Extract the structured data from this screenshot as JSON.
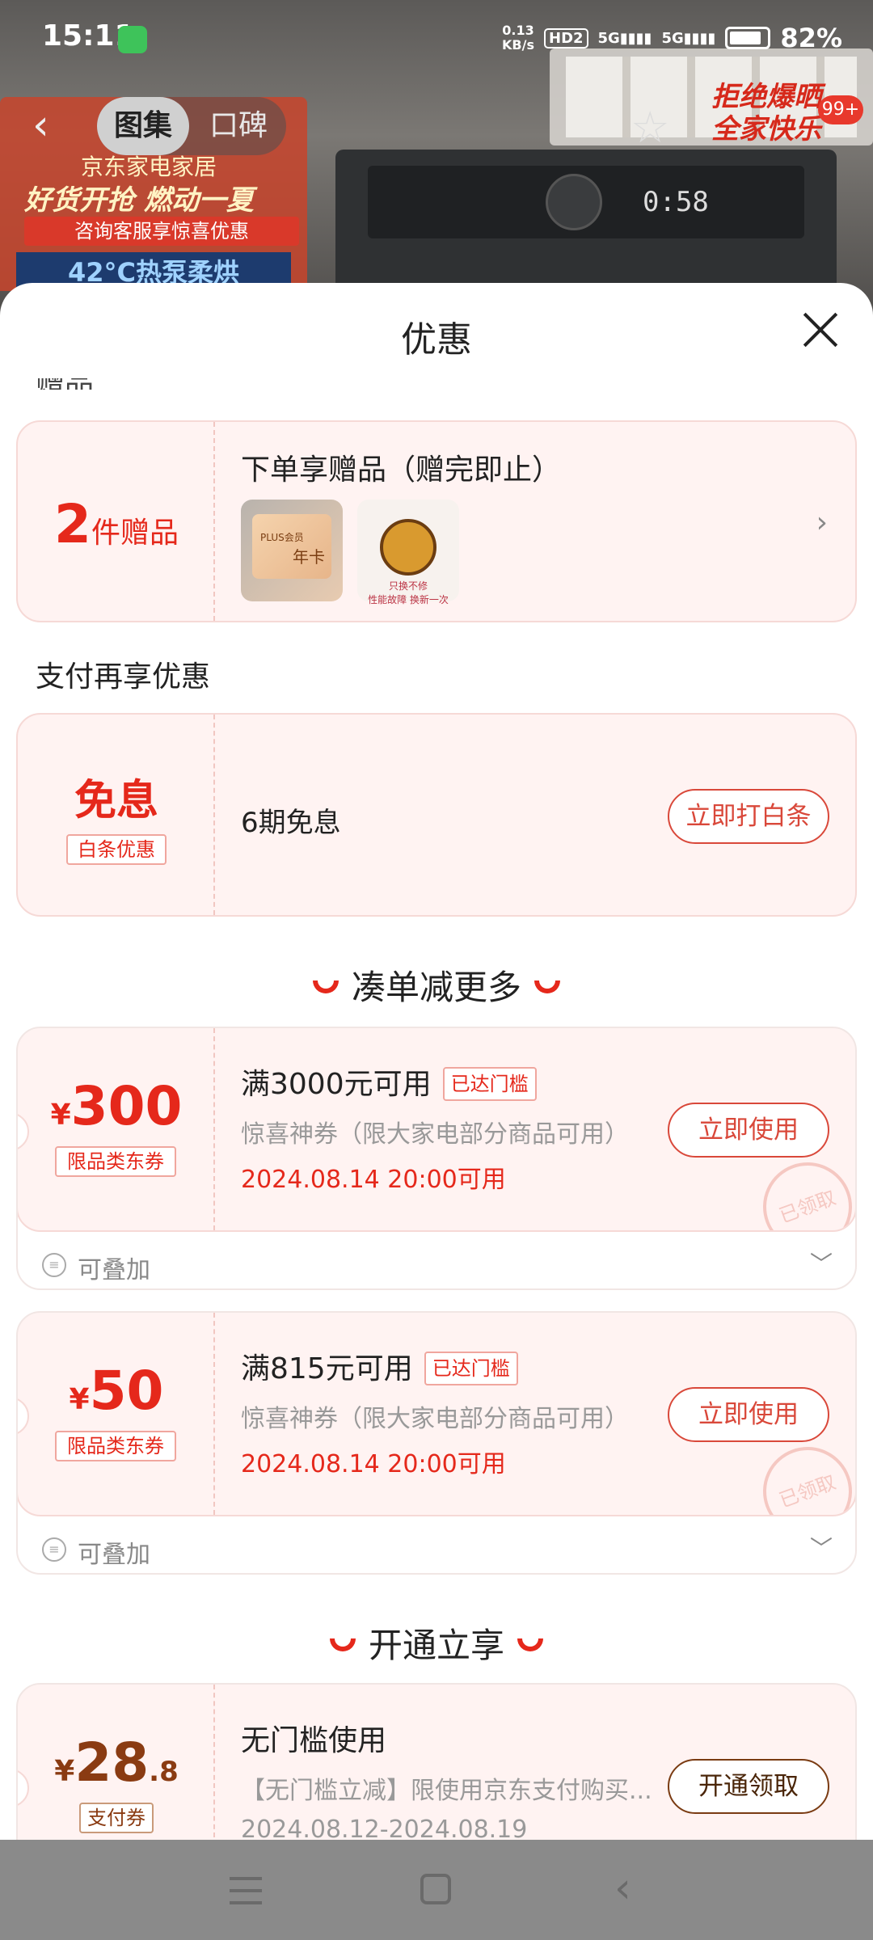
{
  "status_bar": {
    "time": "15:11",
    "net_speed_value": "0.13",
    "net_speed_unit": "KB/s",
    "hd_label": "HD2",
    "signal1": "5G",
    "signal2": "5G",
    "battery": "82%"
  },
  "background": {
    "house_line1": "京东家电家居",
    "house_line2": "好货开抢 燃动一夏",
    "house_line3": "咨询客服享惊喜优惠",
    "house_line4": "42°C热泵柔烘",
    "washer_display": "0:58",
    "promo_text": "拒绝爆晒 全家快乐",
    "promo_badge": "99+"
  },
  "top_nav": {
    "back_icon": "chevron-left-icon",
    "tabs": [
      "图集",
      "口碑"
    ],
    "active_tab": 0,
    "favorite_icon": "star-icon"
  },
  "sheet": {
    "title": "优惠",
    "close_icon": "close-icon",
    "cut_text": "赠品",
    "gift": {
      "count": "2",
      "unit": "件赠品",
      "title": "下单享赠品（赠完即止）",
      "image1_label": "年卡",
      "image1_sublabel": "PLUS会员",
      "image2_label": "只换不修",
      "image2_caption": "性能故障 换新一次"
    },
    "pay_section_label": "支付再享优惠",
    "pay": {
      "big": "免息",
      "tag": "白条优惠",
      "text": "6期免息",
      "button": "立即打白条"
    },
    "more_section_title": "凑单减更多",
    "coupons": [
      {
        "yen": "¥",
        "amount": "300",
        "tag": "限品类东券",
        "title": "满3000元可用",
        "reached": "已达门槛",
        "desc": "惊喜神券（限大家电部分商品可用）",
        "date": "2024.08.14 20:00可用",
        "button": "立即使用",
        "stamp": "已领取",
        "stack": "可叠加"
      },
      {
        "yen": "¥",
        "amount": "50",
        "tag": "限品类东券",
        "title": "满815元可用",
        "reached": "已达门槛",
        "desc": "惊喜神券（限大家电部分商品可用）",
        "date": "2024.08.14 20:00可用",
        "button": "立即使用",
        "stamp": "已领取",
        "stack": "可叠加"
      }
    ],
    "open_section_title": "开通立享",
    "open_coupon": {
      "yen": "¥",
      "amount": "28",
      "decimal": ".8",
      "tag": "支付券",
      "title": "无门槛使用",
      "desc": "【无门槛立减】限使用京东支付购买...",
      "date": "2024.08.12-2024.08.19",
      "button": "开通领取"
    }
  },
  "nav_bar": {
    "menu_icon": "menu-icon",
    "home_icon": "home-icon",
    "back_icon": "back-icon"
  },
  "colors": {
    "accent_red": "#e5281b",
    "card_bg": "#fff3f2",
    "brown": "#8a3b12"
  }
}
